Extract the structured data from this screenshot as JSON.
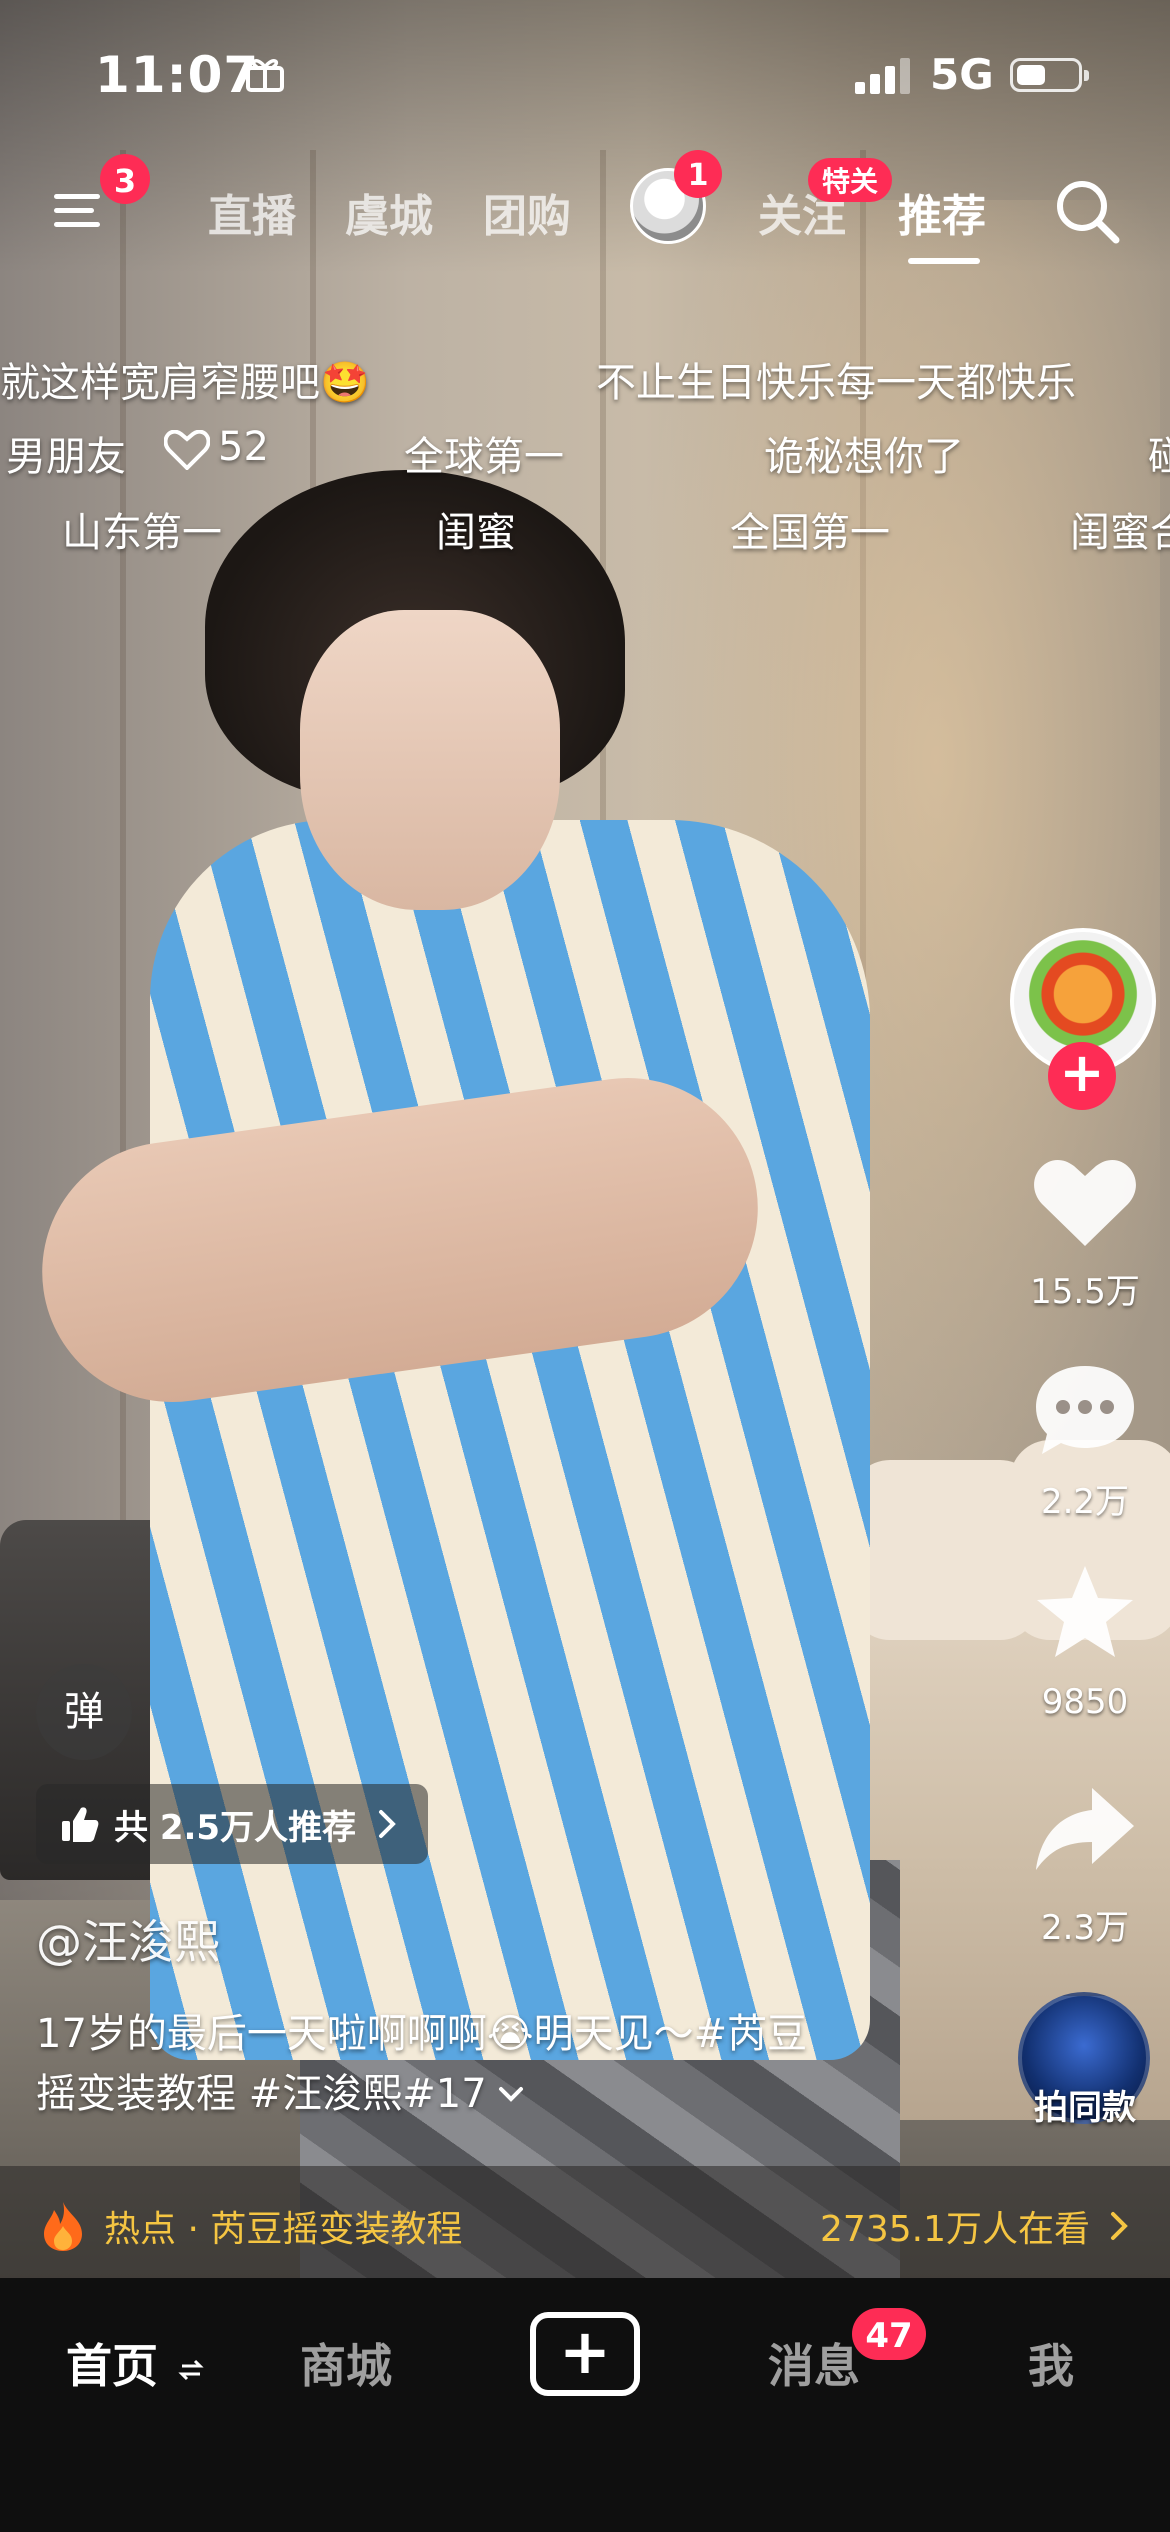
{
  "status_bar": {
    "time": "11:07",
    "network": "5G"
  },
  "top_nav": {
    "menu_badge": "3",
    "tabs": [
      "直播",
      "虞城",
      "团购"
    ],
    "avatar_badge": "1",
    "follow_label": "关注",
    "follow_tag": "特关",
    "recommend_label": "推荐"
  },
  "danmaku": [
    {
      "text": "就这样宽肩窄腰吧🤩"
    },
    {
      "text": "不止生日快乐每一天都快乐"
    },
    {
      "text": "男朋友"
    },
    {
      "text": "52"
    },
    {
      "text": "全球第一"
    },
    {
      "text": "诡秘想你了"
    },
    {
      "text": "碰"
    },
    {
      "text": "山东第一"
    },
    {
      "text": "闺蜜"
    },
    {
      "text": "全国第一"
    },
    {
      "text": "闺蜜合"
    }
  ],
  "side_actions": {
    "likes": "15.5万",
    "comments": "2.2万",
    "favorites": "9850",
    "shares": "2.3万",
    "music_label": "拍同款"
  },
  "overlay": {
    "danmaku_toggle": "弹",
    "recommend_count": "共 2.5万人推荐",
    "author": "@汪浚熙",
    "caption_line1": "17岁的最后一天啦啊啊啊😭明天见～#芮豆",
    "caption_line2": "摇变装教程 #汪浚熙#17"
  },
  "hot_bar": {
    "topic": "热点 · 芮豆摇变装教程",
    "watching": "2735.1万人在看"
  },
  "bottom_tabs": {
    "home": "首页",
    "mall": "商城",
    "plus": "+",
    "messages": "消息",
    "messages_badge": "47",
    "me": "我"
  },
  "colors": {
    "badge": "#fe2c55",
    "hot_text": "#f5c542",
    "tab_bar": "#0f0f0f"
  }
}
